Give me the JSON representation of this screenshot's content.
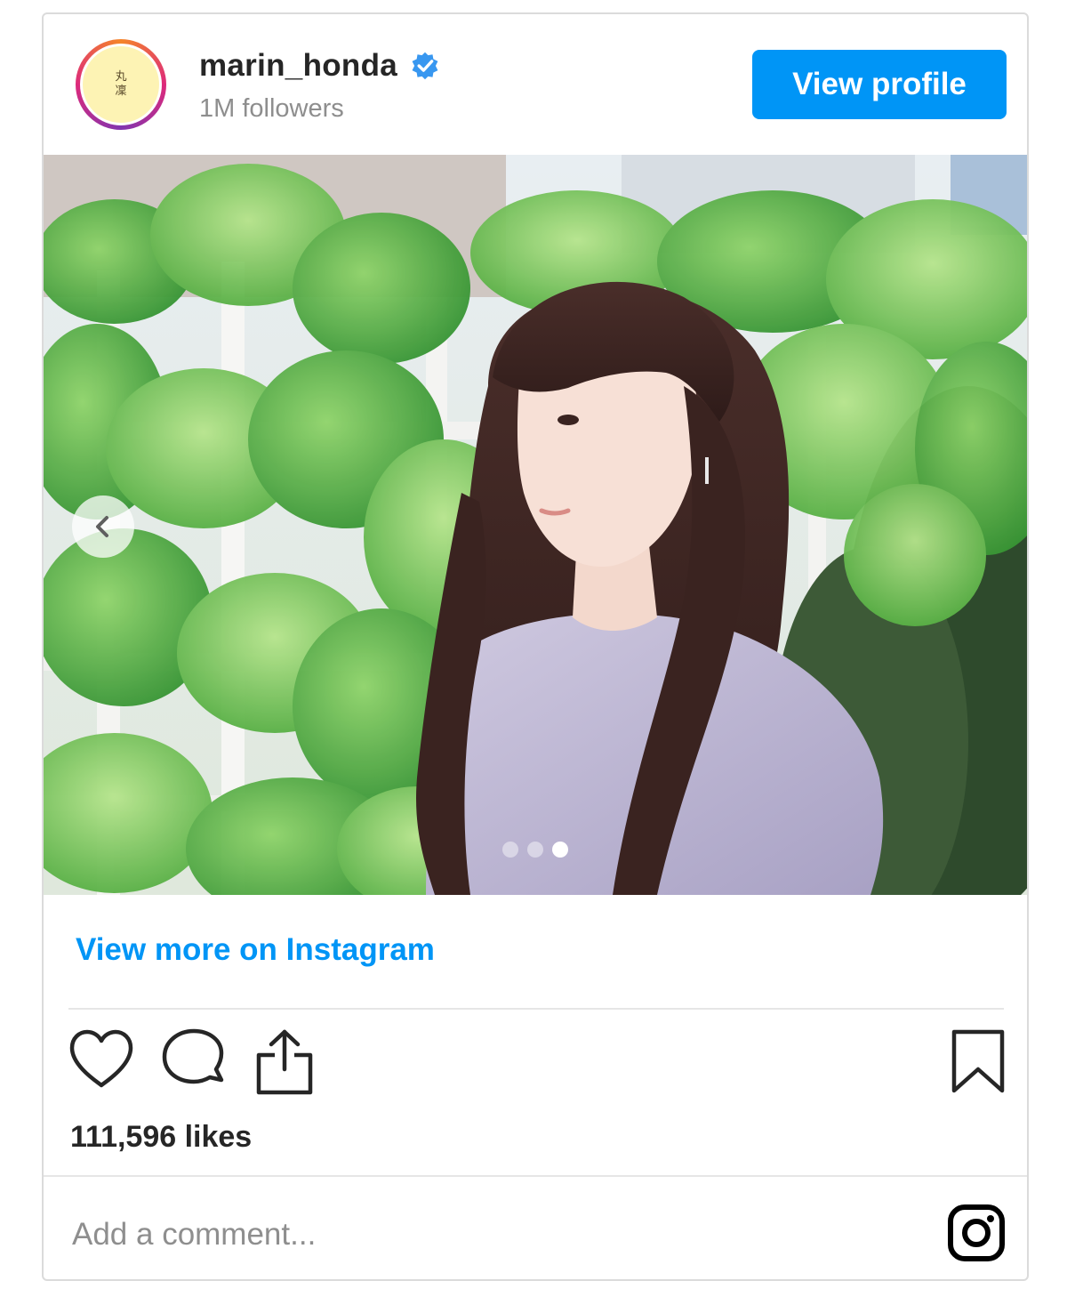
{
  "profile": {
    "username": "marin_honda",
    "followers": "1M followers",
    "avatar_text_line1": "丸",
    "avatar_text_line2": "凜",
    "verified_icon": "verified-badge-icon",
    "view_profile_label": "View profile"
  },
  "media": {
    "current_slide": 3,
    "total_slides": 3,
    "prev_icon": "chevron-left-icon"
  },
  "links": {
    "view_more_label": "View more on Instagram"
  },
  "actions": {
    "like_icon": "heart-icon",
    "comment_icon": "comment-icon",
    "share_icon": "share-icon",
    "save_icon": "bookmark-icon"
  },
  "likes": "111,596 likes",
  "comment": {
    "placeholder": "Add a comment...",
    "value": ""
  },
  "footer": {
    "logo_icon": "instagram-logo-icon"
  },
  "colors": {
    "accent": "#0095f6",
    "text": "#262626",
    "secondary_text": "#8e8e8e",
    "border": "#dbdbdb"
  }
}
